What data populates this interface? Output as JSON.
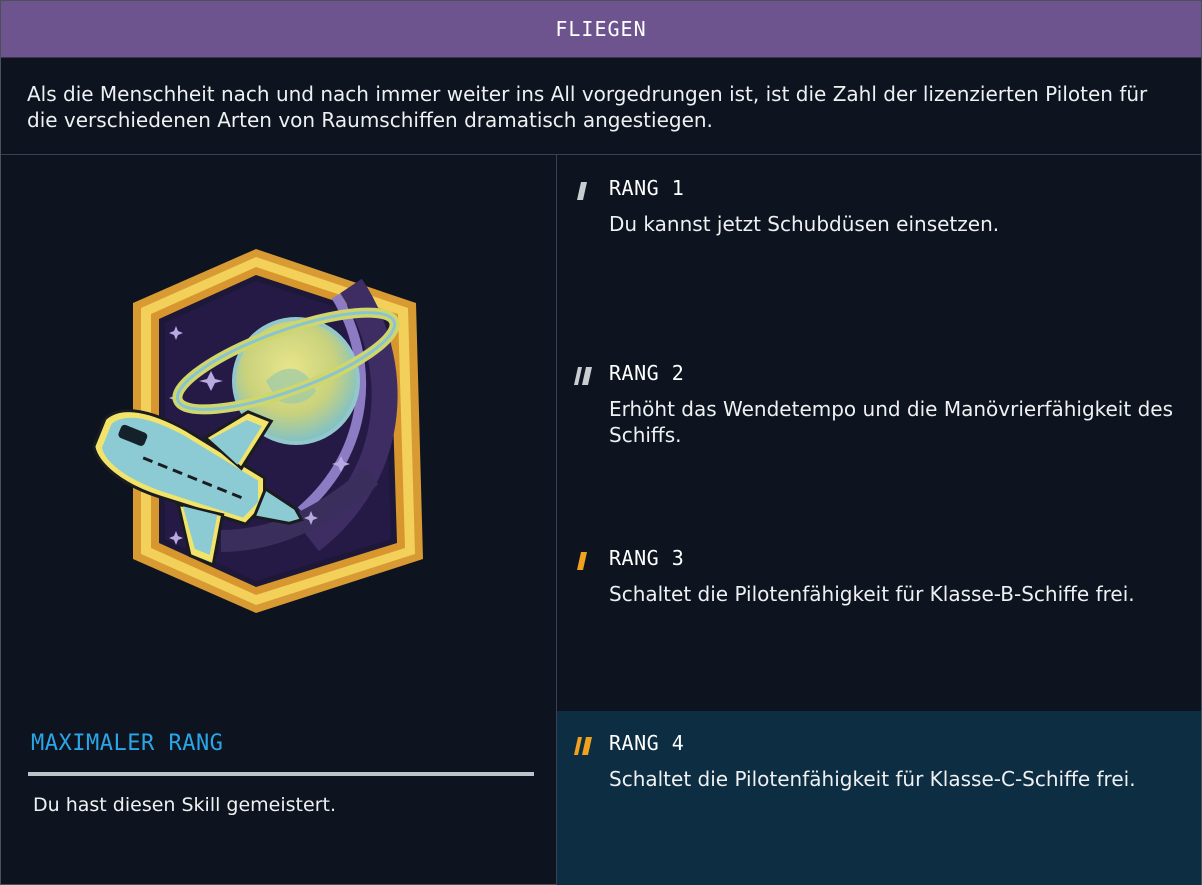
{
  "header": {
    "title": "FLIEGEN"
  },
  "description": "Als die Menschheit nach und nach immer weiter ins All vorgedrungen ist, ist die Zahl der lizenzierten Piloten für die verschiedenen Arten von Raumschiffen dramatisch angestiegen.",
  "badge": {
    "icon": "space-shuttle-planet-patch"
  },
  "max_rank": {
    "title": "MAXIMALER RANG",
    "text": "Du hast diesen Skill gemeistert."
  },
  "ranks": [
    {
      "title": "RANG 1",
      "text": "Du kannst jetzt Schubdüsen einsetzen.",
      "icon": "rank-1-icon",
      "color": "#c9ccd1"
    },
    {
      "title": "RANG 2",
      "text": "Erhöht das Wendetempo und die Manövrierfähigkeit des Schiffs.",
      "icon": "rank-2-icon",
      "color": "#c9ccd1"
    },
    {
      "title": "RANG 3",
      "text": "Schaltet die Pilotenfähigkeit für Klasse-B-Schiffe frei.",
      "icon": "rank-3-icon",
      "color": "#f0a21e"
    },
    {
      "title": "RANG 4",
      "text": "Schaltet die Pilotenfähigkeit für Klasse-C-Schiffe frei.",
      "icon": "rank-4-icon",
      "color": "#f0a21e",
      "active": true
    }
  ],
  "colors": {
    "header_bg": "#6d548e",
    "panel_bg": "#0d141f",
    "accent_blue": "#2aa6e8",
    "rank_active_bg": "#0d2d42",
    "rank_orange": "#f0a21e"
  }
}
